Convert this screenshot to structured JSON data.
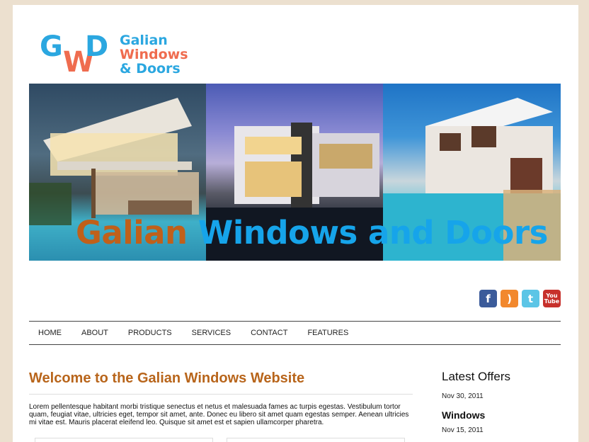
{
  "logo": {
    "mark": "GWD",
    "line1": "Galian",
    "line2": "Windows",
    "line3": "& Doors"
  },
  "banner": {
    "title_part1": "Galian",
    "title_part2": "Windows and Doors"
  },
  "social": [
    {
      "name": "facebook-icon",
      "glyph": "f"
    },
    {
      "name": "rss-icon",
      "glyph": ")"
    },
    {
      "name": "twitter-icon",
      "glyph": "t"
    },
    {
      "name": "youtube-icon",
      "glyph": "You Tube"
    }
  ],
  "nav": {
    "items": [
      "HOME",
      "ABOUT",
      "PRODUCTS",
      "SERVICES",
      "CONTACT",
      "FEATURES"
    ]
  },
  "main": {
    "welcome_title": "Welcome to the Galian Windows Website",
    "body": "Lorem pellentesque habitant morbi tristique senectus et netus et malesuada fames ac turpis egestas. Vestibulum tortor quam, feugiat vitae, ultricies eget, tempor sit amet, ante. Donec eu libero sit amet quam egestas semper. Aenean ultricies mi vitae est. Mauris placerat eleifend leo. Quisque sit amet est et sapien ullamcorper pharetra."
  },
  "sidebar": {
    "title": "Latest Offers",
    "date1": "Nov 30, 2011",
    "heading1": "Windows",
    "date2": "Nov 15, 2011"
  },
  "colors": {
    "background": "#ece0cf",
    "brand_blue": "#2ba7e0",
    "brand_orange": "#ef6c4f",
    "heading_orange": "#b8651b"
  }
}
